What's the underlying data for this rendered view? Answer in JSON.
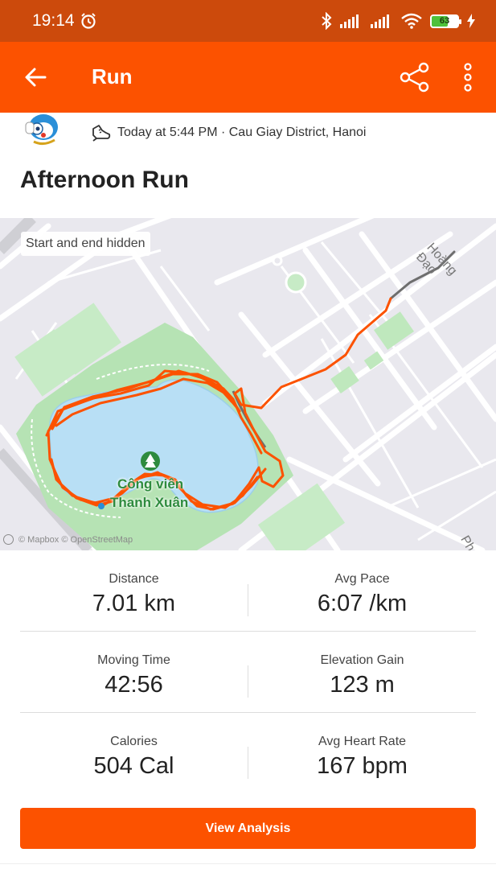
{
  "status_bar": {
    "time": "19:14",
    "battery": "63",
    "battery_level": 0.63
  },
  "app_bar": {
    "title": "Run"
  },
  "activity": {
    "meta": "Today at 5:44 PM · Cau Giay District, Hanoi",
    "title": "Afternoon Run"
  },
  "map": {
    "hidden_chip": "Start and end hidden",
    "attribution": "© Mapbox © OpenStreetMap",
    "park_label_1": "Công viên",
    "park_label_2": "Thanh Xuân",
    "road_label_1": "Hoàng Đạo",
    "road_label_2": "Ph",
    "route_color": "#fc5200",
    "hidden_route_color": "#6e6e6e"
  },
  "stats": [
    {
      "label": "Distance",
      "value": "7.01 km"
    },
    {
      "label": "Avg Pace",
      "value": "6:07 /km"
    },
    {
      "label": "Moving Time",
      "value": "42:56"
    },
    {
      "label": "Elevation Gain",
      "value": "123 m"
    },
    {
      "label": "Calories",
      "value": "504 Cal"
    },
    {
      "label": "Avg Heart Rate",
      "value": "167 bpm"
    }
  ],
  "actions": {
    "view_analysis": "View Analysis"
  },
  "colors": {
    "brand": "#fc5200",
    "status_bar": "#cc4a0c"
  }
}
